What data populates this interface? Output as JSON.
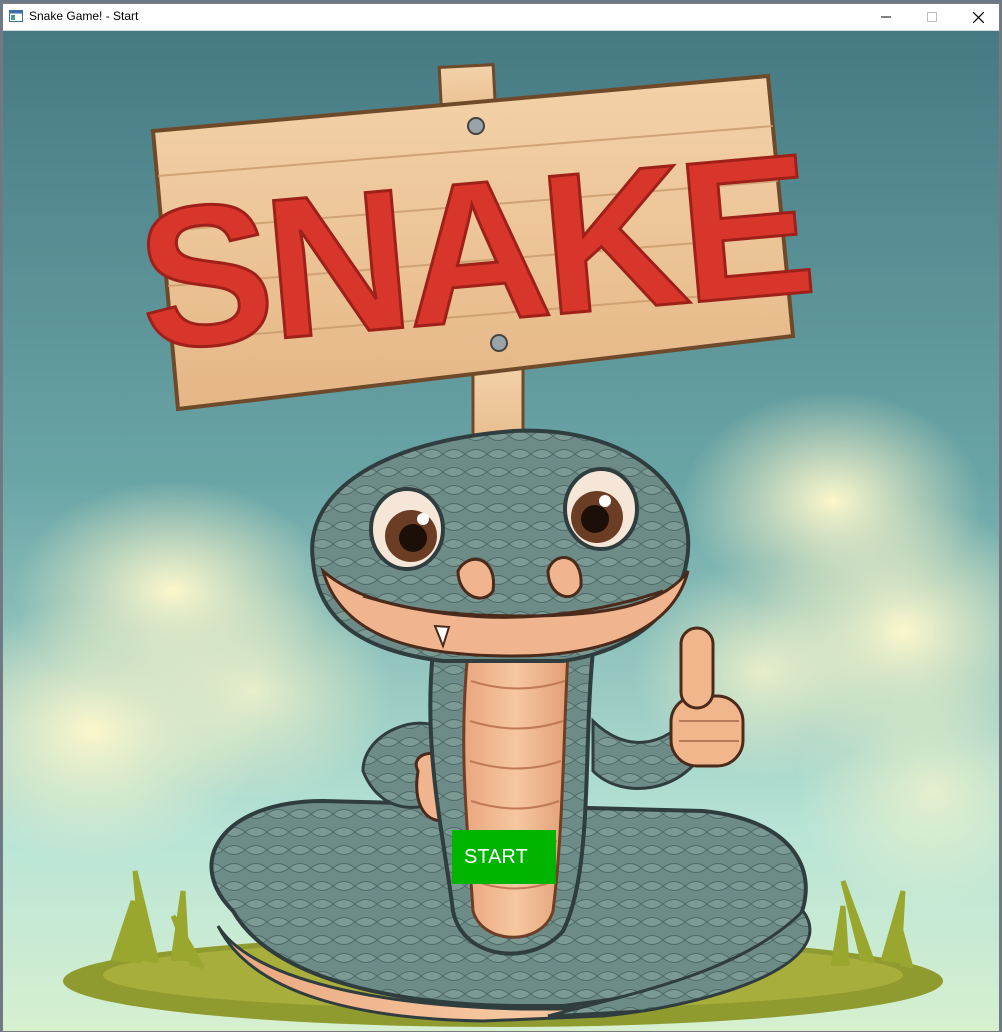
{
  "window": {
    "title": "Snake Game! - Start",
    "controls": {
      "minimize": "minimize-icon",
      "maximize": "maximize-icon",
      "close": "close-icon"
    }
  },
  "sign": {
    "text": "SNAKE",
    "text_color": "#d8352b"
  },
  "start_button": {
    "label": "START",
    "color": "#00b400"
  },
  "colors": {
    "sky_top": "#4c8088",
    "sky_bottom": "#b9e6d9",
    "wood": "#efc89b",
    "snake_scales": "#6b8a86",
    "snake_belly": "#f0b48e"
  }
}
